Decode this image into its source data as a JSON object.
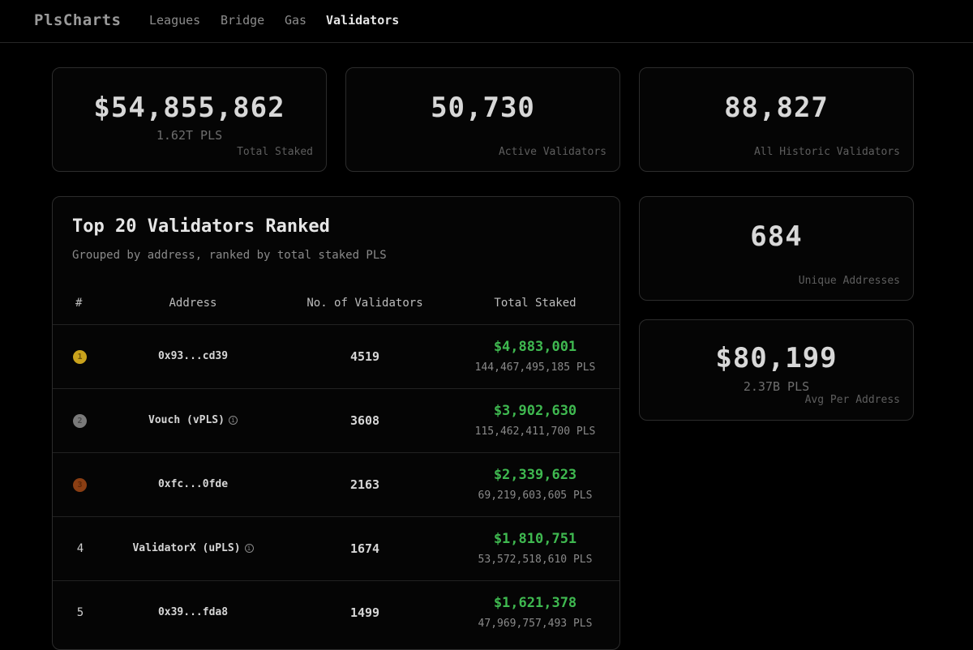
{
  "nav": {
    "brand": "PlsCharts",
    "links": [
      "Leagues",
      "Bridge",
      "Gas",
      "Validators"
    ],
    "active": "Validators"
  },
  "stats": {
    "total_staked": {
      "value": "$54,855,862",
      "sub": "1.62T PLS",
      "label": "Total Staked"
    },
    "active_validators": {
      "value": "50,730",
      "label": "Active Validators"
    },
    "historic_validators": {
      "value": "88,827",
      "label": "All Historic Validators"
    },
    "unique_addresses": {
      "value": "684",
      "label": "Unique Addresses"
    },
    "avg_per_address": {
      "value": "$80,199",
      "sub": "2.37B PLS",
      "label": "Avg Per Address"
    }
  },
  "table": {
    "title": "Top 20 Validators Ranked",
    "subtitle": "Grouped by address, ranked by total staked PLS",
    "headers": {
      "rank": "#",
      "address": "Address",
      "count": "No. of Validators",
      "staked": "Total Staked"
    },
    "rows": [
      {
        "rank": "1",
        "medal": "gold",
        "address": "0x93...cd39",
        "info": false,
        "count": "4519",
        "usd": "$4,883,001",
        "pls": "144,467,495,185 PLS"
      },
      {
        "rank": "2",
        "medal": "silver",
        "address": "Vouch (vPLS)",
        "info": true,
        "count": "3608",
        "usd": "$3,902,630",
        "pls": "115,462,411,700 PLS"
      },
      {
        "rank": "3",
        "medal": "bronze",
        "address": "0xfc...0fde",
        "info": false,
        "count": "2163",
        "usd": "$2,339,623",
        "pls": "69,219,603,605 PLS"
      },
      {
        "rank": "4",
        "medal": "",
        "address": "ValidatorX (uPLS)",
        "info": true,
        "count": "1674",
        "usd": "$1,810,751",
        "pls": "53,572,518,610 PLS"
      },
      {
        "rank": "5",
        "medal": "",
        "address": "0x39...fda8",
        "info": false,
        "count": "1499",
        "usd": "$1,621,378",
        "pls": "47,969,757,493 PLS"
      }
    ]
  },
  "colors": {
    "background": "#000000",
    "accent_green": "#3fb950",
    "border": "#2c2c2c"
  },
  "icons": {
    "info": "info-icon",
    "medal": "medal-icon"
  }
}
